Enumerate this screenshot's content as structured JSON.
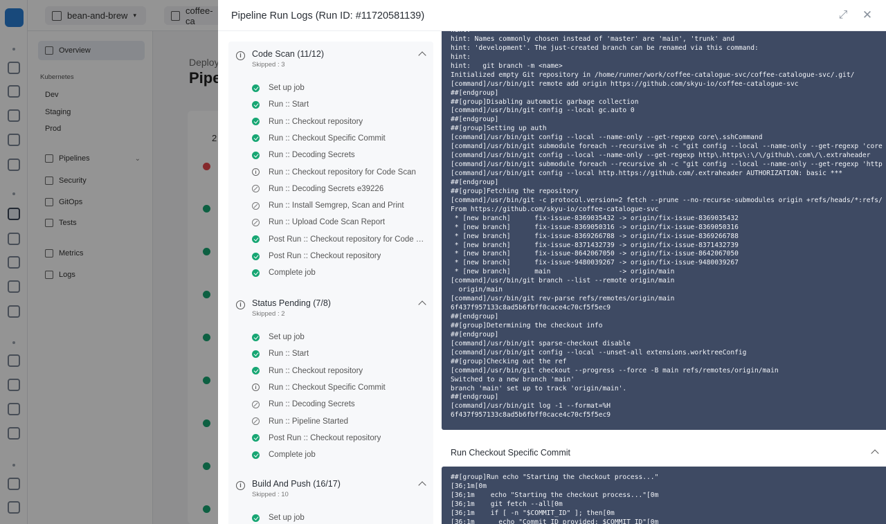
{
  "breadcrumb": {
    "project": "bean-and-brew",
    "service": "coffee-ca"
  },
  "sidebar": {
    "overview": "Overview",
    "kubernetes_heading": "Kubernetes",
    "environments": [
      "Dev",
      "Staging",
      "Prod"
    ],
    "pipelines": "Pipelines",
    "pipeline_items": [
      "Security",
      "GitOps",
      "Tests"
    ],
    "metrics": "Metrics",
    "logs": "Logs"
  },
  "main": {
    "deploy_label": "Deploy",
    "page_title": "Pipe",
    "count": "2"
  },
  "modal": {
    "title": "Pipeline Run Logs (Run ID: #11720581139)"
  },
  "groups": [
    {
      "title": "Code Scan (11/12)",
      "subtitle": "Skipped : 3",
      "steps": [
        {
          "label": "Set up job",
          "status": "success"
        },
        {
          "label": "Run :: Start",
          "status": "success"
        },
        {
          "label": "Run :: Checkout repository",
          "status": "success"
        },
        {
          "label": "Run :: Checkout Specific Commit",
          "status": "success"
        },
        {
          "label": "Run :: Decoding Secrets",
          "status": "success"
        },
        {
          "label": "Run :: Checkout repository for Code Scan",
          "status": "info"
        },
        {
          "label": "Run :: Decoding Secrets e39226",
          "status": "skipped"
        },
        {
          "label": "Run :: Install Semgrep, Scan and Print",
          "status": "skipped"
        },
        {
          "label": "Run :: Upload Code Scan Report",
          "status": "skipped"
        },
        {
          "label": "Post Run :: Checkout repository for Code S...",
          "status": "success"
        },
        {
          "label": "Post Run :: Checkout repository",
          "status": "success"
        },
        {
          "label": "Complete job",
          "status": "success"
        }
      ]
    },
    {
      "title": "Status Pending (7/8)",
      "subtitle": "Skipped : 2",
      "steps": [
        {
          "label": "Set up job",
          "status": "success"
        },
        {
          "label": "Run :: Start",
          "status": "success"
        },
        {
          "label": "Run :: Checkout repository",
          "status": "success"
        },
        {
          "label": "Run :: Checkout Specific Commit",
          "status": "info"
        },
        {
          "label": "Run :: Decoding Secrets",
          "status": "skipped"
        },
        {
          "label": "Run :: Pipeline Started",
          "status": "skipped"
        },
        {
          "label": "Post Run :: Checkout repository",
          "status": "success"
        },
        {
          "label": "Complete job",
          "status": "success"
        }
      ]
    },
    {
      "title": "Build And Push (16/17)",
      "subtitle": "Skipped : 10",
      "steps": [
        {
          "label": "Set up job",
          "status": "success"
        }
      ]
    }
  ],
  "log_main": [
    "hint:",
    "hint: Names commonly chosen instead of 'master' are 'main', 'trunk' and",
    "hint: 'development'. The just-created branch can be renamed via this command:",
    "hint:",
    "hint:   git branch -m <name>",
    "Initialized empty Git repository in /home/runner/work/coffee-catalogue-svc/coffee-catalogue-svc/.git/",
    "[command]/usr/bin/git remote add origin https://github.com/skyu-io/coffee-catalogue-svc",
    "##[endgroup]",
    "##[group]Disabling automatic garbage collection",
    "[command]/usr/bin/git config --local gc.auto 0",
    "##[endgroup]",
    "##[group]Setting up auth",
    "[command]/usr/bin/git config --local --name-only --get-regexp core\\.sshCommand",
    "[command]/usr/bin/git submodule foreach --recursive sh -c \"git config --local --name-only --get-regexp 'core",
    "[command]/usr/bin/git config --local --name-only --get-regexp http\\.https\\:\\/\\/github\\.com\\/\\.extraheader",
    "[command]/usr/bin/git submodule foreach --recursive sh -c \"git config --local --name-only --get-regexp 'http",
    "[command]/usr/bin/git config --local http.https://github.com/.extraheader AUTHORIZATION: basic ***",
    "##[endgroup]",
    "##[group]Fetching the repository",
    "[command]/usr/bin/git -c protocol.version=2 fetch --prune --no-recurse-submodules origin +refs/heads/*:refs/",
    "From https://github.com/skyu-io/coffee-catalogue-svc",
    " * [new branch]      fix-issue-8369035432 -> origin/fix-issue-8369035432",
    " * [new branch]      fix-issue-8369050316 -> origin/fix-issue-8369050316",
    " * [new branch]      fix-issue-8369266788 -> origin/fix-issue-8369266788",
    " * [new branch]      fix-issue-8371432739 -> origin/fix-issue-8371432739",
    " * [new branch]      fix-issue-8642067050 -> origin/fix-issue-8642067050",
    " * [new branch]      fix-issue-9480039267 -> origin/fix-issue-9480039267",
    " * [new branch]      main                 -> origin/main",
    "[command]/usr/bin/git branch --list --remote origin/main",
    "  origin/main",
    "[command]/usr/bin/git rev-parse refs/remotes/origin/main",
    "6f437f957133c8ad5b6fbff0cace4c70cf5f5ec9",
    "##[endgroup]",
    "##[group]Determining the checkout info",
    "##[endgroup]",
    "[command]/usr/bin/git sparse-checkout disable",
    "[command]/usr/bin/git config --local --unset-all extensions.worktreeConfig",
    "##[group]Checking out the ref",
    "[command]/usr/bin/git checkout --progress --force -B main refs/remotes/origin/main",
    "Switched to a new branch 'main'",
    "branch 'main' set up to track 'origin/main'.",
    "##[endgroup]",
    "[command]/usr/bin/git log -1 --format=%H",
    "6f437f957133c8ad5b6fbff0cace4c70cf5f5ec9"
  ],
  "section2_title": "Run Checkout Specific Commit",
  "log_section2": [
    "##[group]Run echo \"Starting the checkout process...\"",
    "[36;1m[0m",
    "[36;1m    echo \"Starting the checkout process...\"[0m",
    "[36;1m    git fetch --all[0m",
    "[36;1m    if [ -n \"$COMMIT_ID\" ]; then[0m",
    "[36;1m      echo \"Commit ID provided: $COMMIT_ID\"[0m"
  ]
}
